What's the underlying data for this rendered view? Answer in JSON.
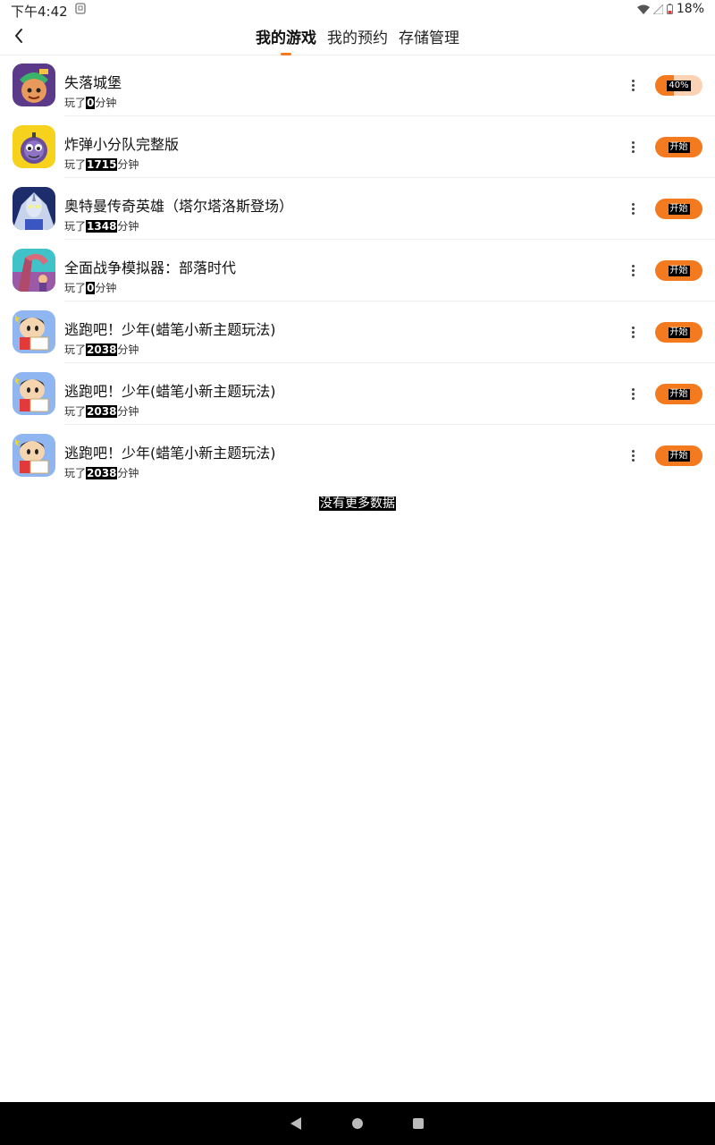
{
  "status_bar": {
    "time": "下午4:42",
    "battery": "18%"
  },
  "header": {
    "tabs": [
      {
        "label": "我的游戏",
        "active": true
      },
      {
        "label": "我的预约",
        "active": false
      },
      {
        "label": "存储管理",
        "active": false
      }
    ]
  },
  "accent_color": "#f47a1f",
  "games": [
    {
      "title": "失落城堡",
      "played_prefix": "玩了",
      "minutes": "0",
      "played_suffix": "分钟",
      "action": "40%",
      "progress": 0.4,
      "icon": "lost-castle-icon"
    },
    {
      "title": "炸弹小分队完整版",
      "played_prefix": "玩了",
      "minutes": "1715",
      "played_suffix": "分钟",
      "action": "开始",
      "icon": "bomb-squad-icon"
    },
    {
      "title": "奥特曼传奇英雄（塔尔塔洛斯登场）",
      "played_prefix": "玩了",
      "minutes": "1348",
      "played_suffix": "分钟",
      "action": "开始",
      "icon": "ultraman-icon"
    },
    {
      "title": "全面战争模拟器：部落时代",
      "played_prefix": "玩了",
      "minutes": "0",
      "played_suffix": "分钟",
      "action": "开始",
      "icon": "war-simulator-icon"
    },
    {
      "title": "逃跑吧！少年(蜡笔小新主题玩法)",
      "played_prefix": "玩了",
      "minutes": "2038",
      "played_suffix": "分钟",
      "action": "开始",
      "icon": "crayon-shinchan-icon"
    },
    {
      "title": "逃跑吧！少年(蜡笔小新主题玩法)",
      "played_prefix": "玩了",
      "minutes": "2038",
      "played_suffix": "分钟",
      "action": "开始",
      "icon": "crayon-shinchan-icon"
    },
    {
      "title": "逃跑吧！少年(蜡笔小新主题玩法)",
      "played_prefix": "玩了",
      "minutes": "2038",
      "played_suffix": "分钟",
      "action": "开始",
      "icon": "crayon-shinchan-icon"
    }
  ],
  "footer_text": "没有更多数据"
}
